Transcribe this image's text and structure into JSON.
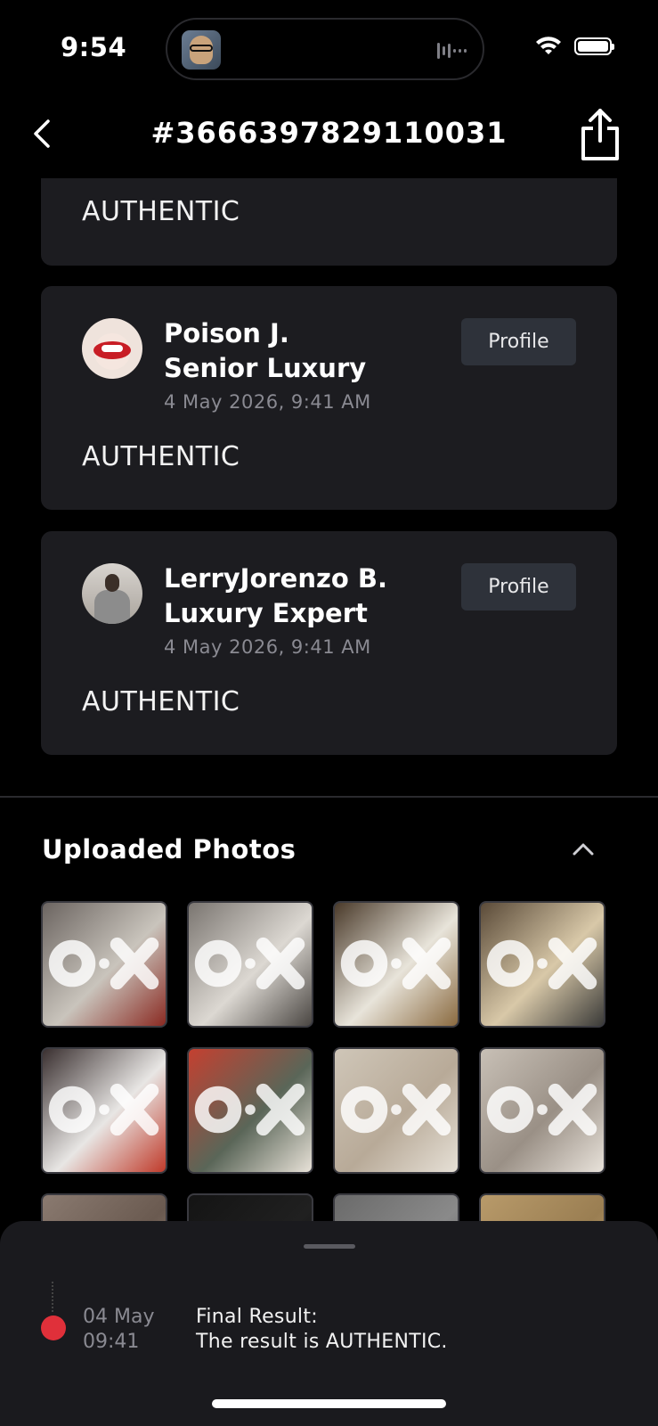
{
  "status_bar": {
    "time": "9:54"
  },
  "nav": {
    "title": "#3666397829110031"
  },
  "verdicts": [
    {
      "verdict": "AUTHENTIC"
    },
    {
      "name_line1": "Poison J.",
      "name_line2": "Senior Luxury",
      "date": "4 May 2026, 9:41 AM",
      "button": "Profile",
      "verdict": "AUTHENTIC",
      "avatar": "lips-avatar"
    },
    {
      "name_line1": "LerryJorenzo B.",
      "name_line2": "Luxury Expert",
      "date": "4 May 2026, 9:41 AM",
      "button": "Profile",
      "verdict": "AUTHENTIC",
      "avatar": "man-avatar"
    }
  ],
  "photos": {
    "title": "Uploaded Photos",
    "items": [
      {
        "subject": "sneaker-side",
        "colors": [
          "#6b6460",
          "#c9c4bc",
          "#8a2a22"
        ]
      },
      {
        "subject": "sneaker-held",
        "colors": [
          "#7a7570",
          "#dcd8d2",
          "#4a4642"
        ]
      },
      {
        "subject": "sneaker-heel",
        "colors": [
          "#4a3a2a",
          "#e8e4da",
          "#8a6a40"
        ]
      },
      {
        "subject": "sole-held",
        "colors": [
          "#5a4a38",
          "#d8c8a8",
          "#3a3a38"
        ]
      },
      {
        "subject": "insole",
        "colors": [
          "#3a3030",
          "#e8e6e4",
          "#c03a2a"
        ]
      },
      {
        "subject": "outsole-green",
        "colors": [
          "#c44030",
          "#5a6658",
          "#e8e2d8"
        ]
      },
      {
        "subject": "monogram-lining",
        "colors": [
          "#cfc6b8",
          "#b8aa98",
          "#e6e0d6"
        ]
      },
      {
        "subject": "sneaker-top",
        "colors": [
          "#c8c0b6",
          "#9a9086",
          "#e8e2da"
        ]
      },
      {
        "subject": "row3-a",
        "colors": [
          "#8a7a70",
          "#6a5a50",
          "#a09080"
        ]
      },
      {
        "subject": "row3-b",
        "colors": [
          "#141414",
          "#202020",
          "#0c0c0c"
        ]
      },
      {
        "subject": "row3-c",
        "colors": [
          "#6a6a6a",
          "#8a8a8a",
          "#505050"
        ]
      },
      {
        "subject": "row3-d",
        "colors": [
          "#b89a6a",
          "#9a7e52",
          "#c8aa7a"
        ]
      }
    ]
  },
  "timeline": {
    "date_line1": "04 May",
    "date_line2": "09:41",
    "text_line1": "Final Result:",
    "text_line2": "The result is AUTHENTIC.",
    "dot_color": "#e0303a"
  }
}
